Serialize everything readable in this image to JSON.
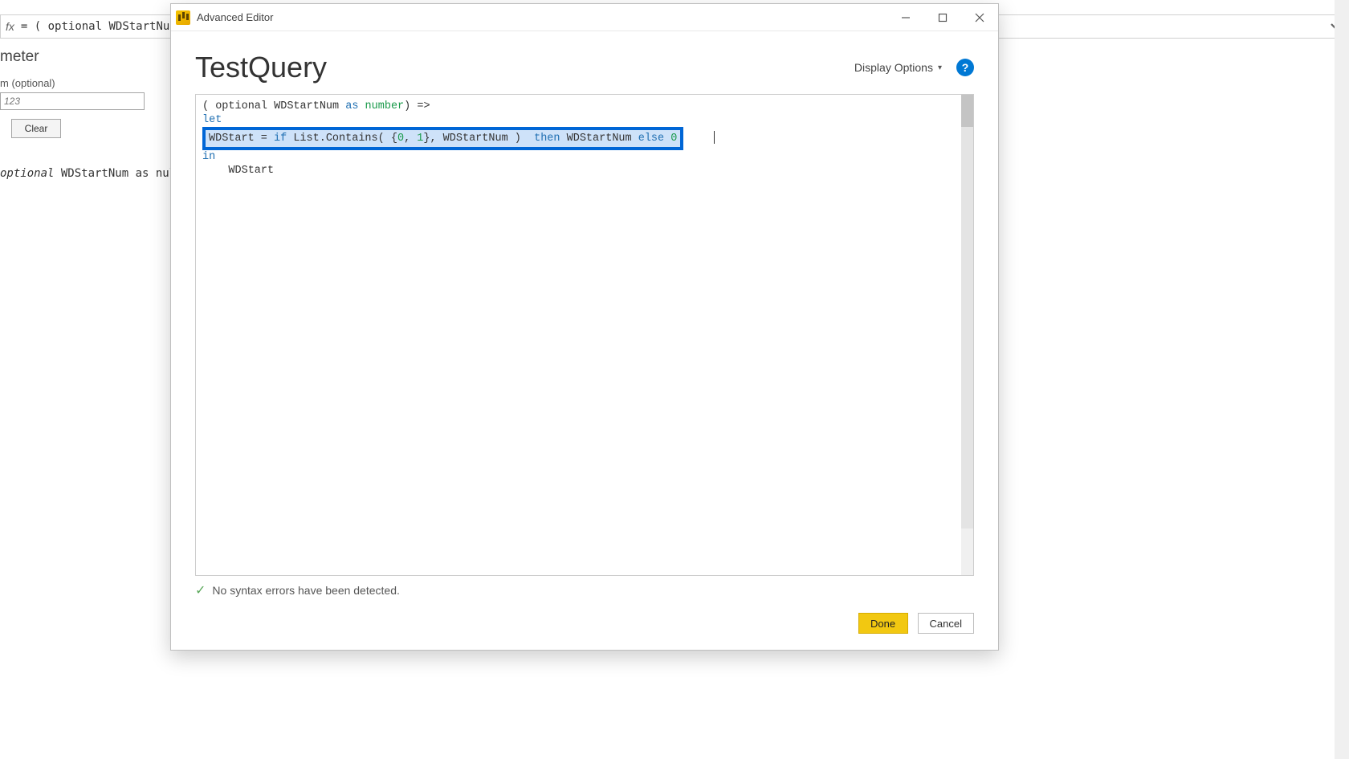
{
  "background": {
    "formula_prefix": "fx",
    "formula_text": "= ( optional WDStartNum a",
    "panel_title": "meter",
    "field_label": "m (optional)",
    "input_placeholder": "123",
    "clear_label": "Clear",
    "code_tail": "optional WDStartNum as nullable n"
  },
  "dialog": {
    "title": "Advanced Editor",
    "query_name": "TestQuery",
    "display_options_label": "Display Options",
    "code": {
      "line1_pre": "( ",
      "line1_optional": "optional",
      "line1_param": " WDStartNum ",
      "line1_as": "as",
      "line1_space": " ",
      "line1_type": "number",
      "line1_post": ") =>",
      "line2_let": "let",
      "line3_var": "WDStart = ",
      "line3_if": "if",
      "line3_mid1": " List.Contains( {",
      "line3_n0": "0",
      "line3_comma": ", ",
      "line3_n1": "1",
      "line3_mid2": "}, WDStartNum )  ",
      "line3_then": "then",
      "line3_mid3": " WDStartNum ",
      "line3_else": "else",
      "line3_sp": " ",
      "line3_n2": "0",
      "line4_in": "in",
      "line5_ret": "WDStart"
    },
    "status_text": "No syntax errors have been detected.",
    "done_label": "Done",
    "cancel_label": "Cancel"
  }
}
